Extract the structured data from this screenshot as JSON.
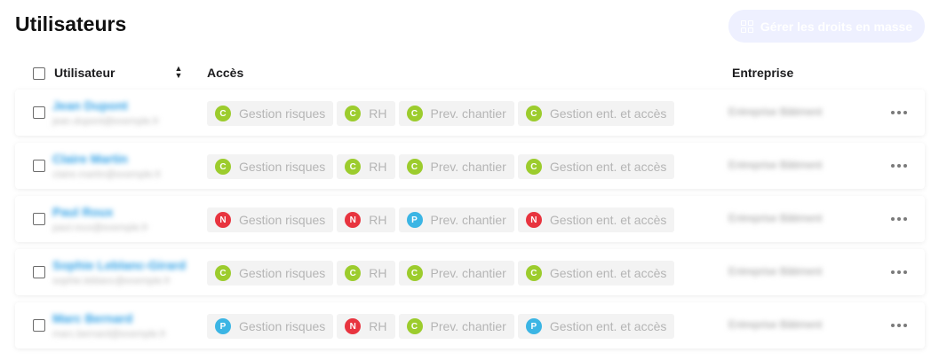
{
  "page": {
    "title": "Utilisateurs"
  },
  "bulk_button": {
    "label": "Gérer les droits en masse",
    "icon": "grid-icon"
  },
  "table": {
    "columns": {
      "user": "Utilisateur",
      "access": "Accès",
      "company": "Entreprise"
    },
    "rows": [
      {
        "user_name": "Jean Dupont",
        "user_email": "jean.dupont@exemple.fr",
        "company": "Entreprise Bâtiment",
        "access": [
          {
            "status": "C",
            "label": "Gestion risques"
          },
          {
            "status": "C",
            "label": "RH"
          },
          {
            "status": "C",
            "label": "Prev. chantier"
          },
          {
            "status": "C",
            "label": "Gestion ent. et accès"
          }
        ]
      },
      {
        "user_name": "Claire Martin",
        "user_email": "claire.martin@exemple.fr",
        "company": "Entreprise Bâtiment",
        "access": [
          {
            "status": "C",
            "label": "Gestion risques"
          },
          {
            "status": "C",
            "label": "RH"
          },
          {
            "status": "C",
            "label": "Prev. chantier"
          },
          {
            "status": "C",
            "label": "Gestion ent. et accès"
          }
        ]
      },
      {
        "user_name": "Paul Roux",
        "user_email": "paul.roux@exemple.fr",
        "company": "Entreprise Bâtiment",
        "access": [
          {
            "status": "N",
            "label": "Gestion risques"
          },
          {
            "status": "N",
            "label": "RH"
          },
          {
            "status": "P",
            "label": "Prev. chantier"
          },
          {
            "status": "N",
            "label": "Gestion ent. et accès"
          }
        ]
      },
      {
        "user_name": "Sophie Leblanc-Girard",
        "user_email": "sophie.leblanc@exemple.fr",
        "company": "Entreprise Bâtiment",
        "access": [
          {
            "status": "C",
            "label": "Gestion risques"
          },
          {
            "status": "C",
            "label": "RH"
          },
          {
            "status": "C",
            "label": "Prev. chantier"
          },
          {
            "status": "C",
            "label": "Gestion ent. et accès"
          }
        ]
      },
      {
        "user_name": "Marc Bernard",
        "user_email": "marc.bernard@exemple.fr",
        "company": "Entreprise Bâtiment",
        "access": [
          {
            "status": "P",
            "label": "Gestion risques"
          },
          {
            "status": "N",
            "label": "RH"
          },
          {
            "status": "C",
            "label": "Prev. chantier"
          },
          {
            "status": "P",
            "label": "Gestion ent. et accès"
          }
        ]
      }
    ]
  },
  "colors": {
    "status_C": "#9ccc2d",
    "status_N": "#e8343f",
    "status_P": "#3bb5e4",
    "link": "#2ea0e6"
  }
}
